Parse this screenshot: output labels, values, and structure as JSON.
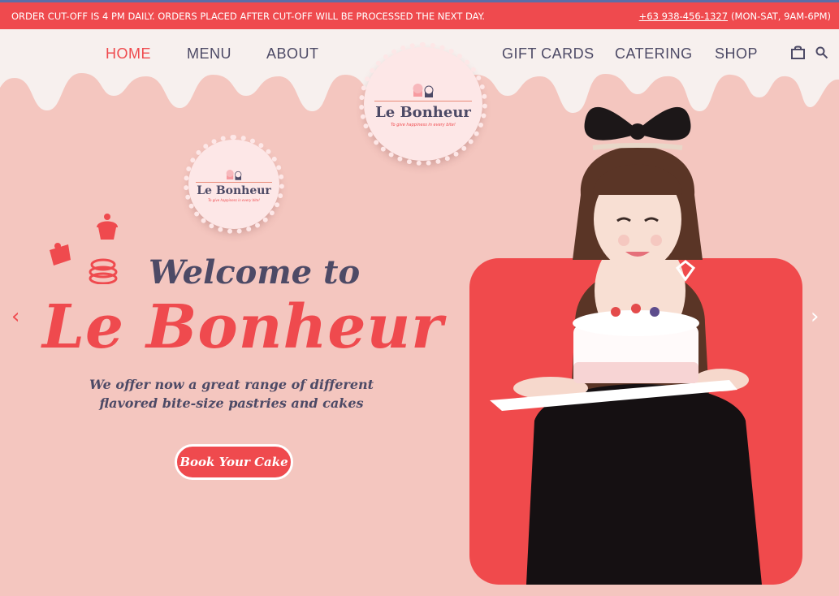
{
  "announcement": {
    "text": "ORDER CUT-OFF IS 4 PM DAILY. ORDERS PLACED AFTER CUT-OFF WILL BE PROCESSED THE NEXT DAY.",
    "phone": "+63 938-456-1327",
    "hours": "(MON-SAT, 9AM-6PM)"
  },
  "nav": {
    "left": [
      "HOME",
      "MENU",
      "ABOUT"
    ],
    "right": [
      "GIFT CARDS",
      "CATERING",
      "SHOP"
    ]
  },
  "logo": {
    "title": "Le Bonheur",
    "tagline": "To give happiness in every bite!"
  },
  "hero": {
    "welcome": "Welcome to",
    "brand": "Le Bonheur",
    "line1": "We offer now a great range of different",
    "line2": "flavored bite-size pastries and cakes",
    "cta": "Book Your Cake"
  },
  "colors": {
    "accent": "#ef4a4e",
    "background": "#f4c6bf",
    "text": "#4d4a66",
    "cream": "#f7f0ee"
  },
  "icons": [
    "shopping-bag-icon",
    "search-icon",
    "chevron-left-icon",
    "chevron-right-icon",
    "cupcake-icon",
    "cake-slice-icon",
    "macaron-icon"
  ]
}
